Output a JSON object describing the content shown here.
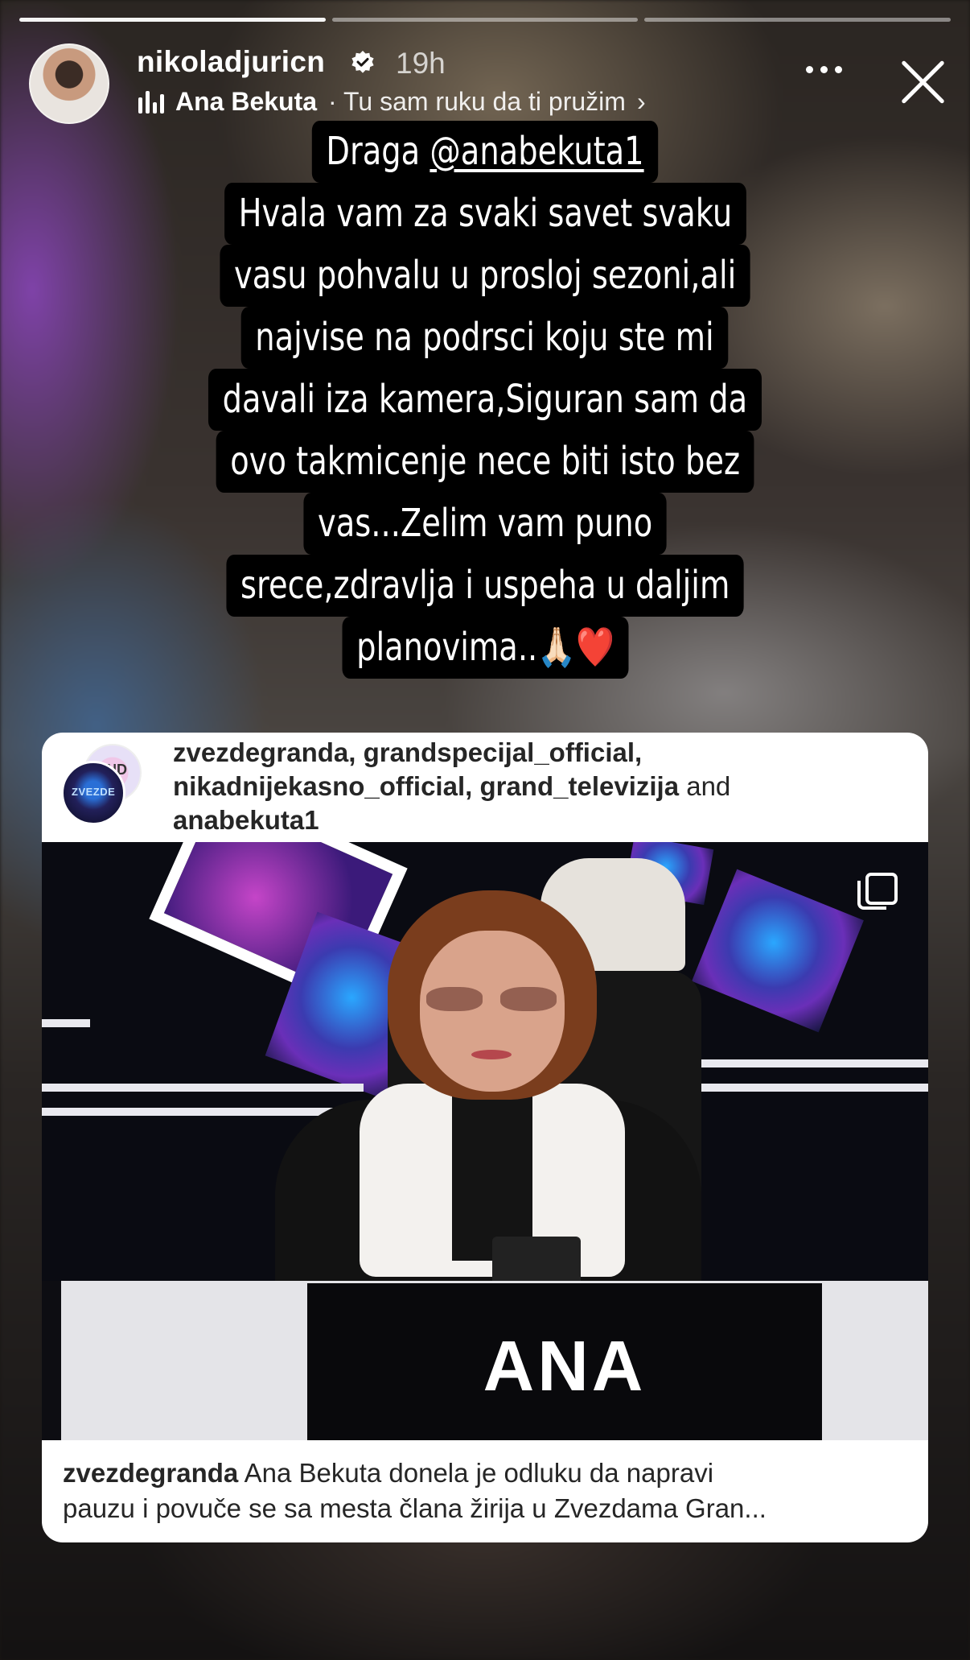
{
  "story": {
    "progress_segments": 3,
    "progress_filled": 1,
    "username": "nikoladjuricn",
    "time_ago": "19h",
    "music": {
      "artist": "Ana Bekuta",
      "separator": " · ",
      "song": "Tu sam ruku da ti pružim",
      "chevron": "›"
    },
    "text": {
      "line1_prefix": "Draga ",
      "mention": "@anabekuta1",
      "line2": "Hvala vam za svaki savet svaku",
      "line3": "vasu pohvalu u prosloj sezoni,ali",
      "line4": "najvise na podrsci koju ste mi",
      "line5": "davali iza kamera,Siguran sam da",
      "line6": "ovo takmicenje nece biti isto bez",
      "line7": "vas...Zelim vam puno",
      "line8": "srece,zdravlja i uspeha u daljim",
      "line9": "planovima..🙏🏻❤️"
    }
  },
  "shared_post": {
    "avatar_text_back": "ND",
    "avatar_text_front": "ZVEZDE",
    "authors_line1": "zvezdegranda, grandspecijal_official,",
    "authors_line2_bold": "nikadnijekasno_official, grand_televizija",
    "authors_line2_rest": " and",
    "authors_line3": "anabekuta1",
    "nameplate": "ANA",
    "caption_user": "zvezdegranda",
    "caption_text_1": " Ana Bekuta donela je odluku da napravi",
    "caption_text_2": "pauzu i povuče se sa mesta člana žirija u Zvezdama Gran..."
  },
  "icons": [
    "verified-icon",
    "music-bars-icon",
    "more-icon",
    "close-icon",
    "multiple-photos-icon"
  ],
  "colors": {
    "verified": "#ffffff",
    "text_bg": "#000000",
    "card_bg": "#ffffff"
  }
}
